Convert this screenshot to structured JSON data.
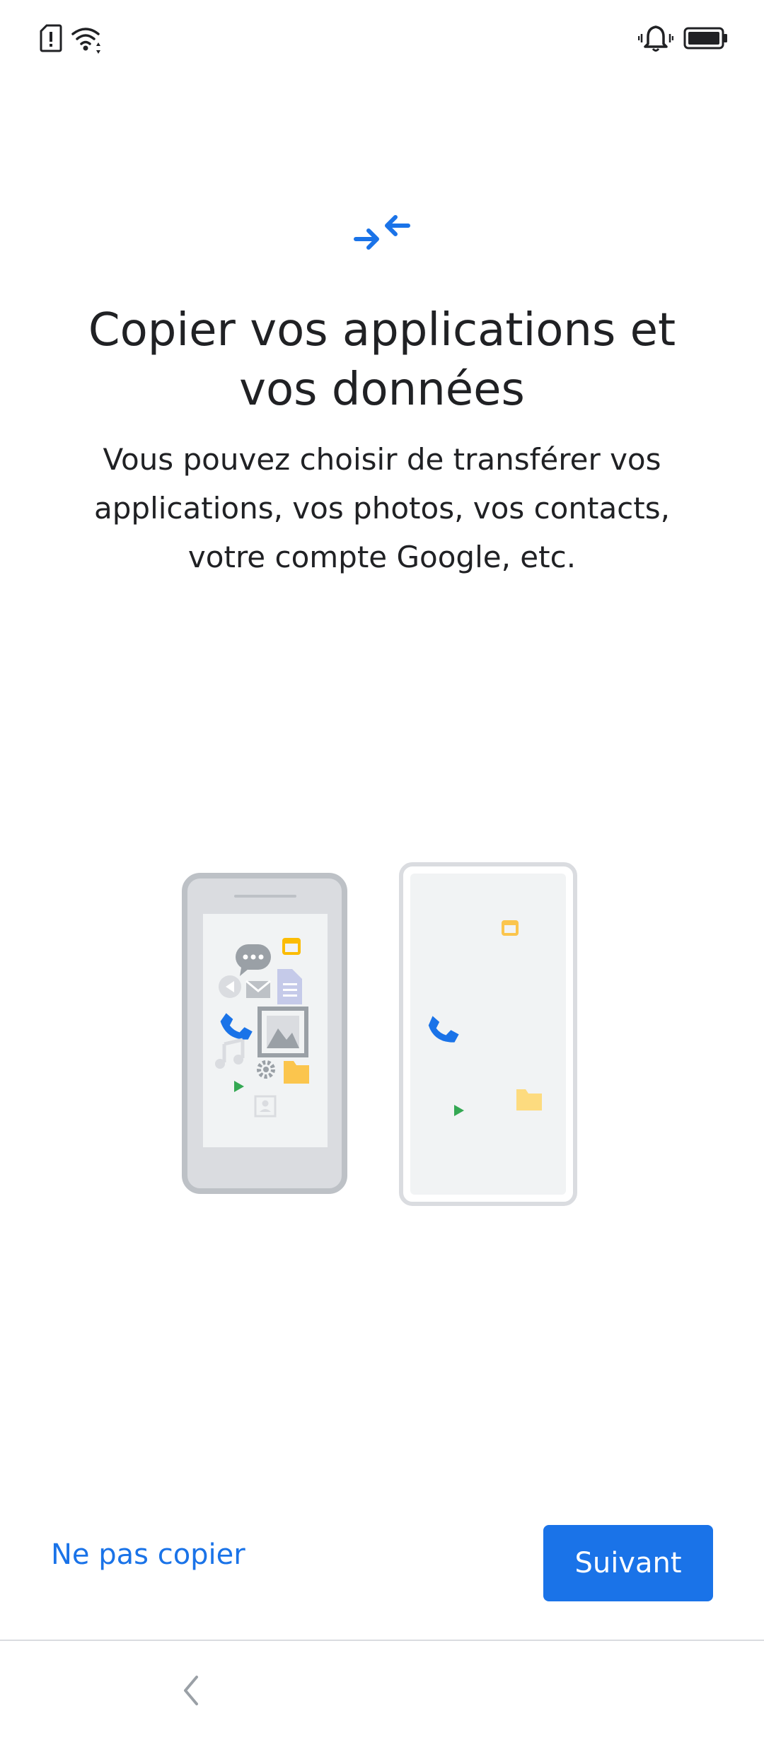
{
  "header": {
    "title": "Copier vos applications et vos données",
    "subtitle": "Vous pouvez choisir de transférer vos applications, vos photos, vos contacts, votre compte Google, etc."
  },
  "icons": {
    "status_left": [
      "sim-alert-icon",
      "wifi-icon"
    ],
    "status_right": [
      "vibrate-bell-icon",
      "battery-icon"
    ],
    "header": "transfer-arrows-icon",
    "nav": "back-icon"
  },
  "actions": {
    "skip_label": "Ne pas copier",
    "next_label": "Suivant"
  },
  "colors": {
    "accent": "#1a73e8",
    "text": "#202124",
    "phone_grey": "#bdc1c6",
    "icon_yellow": "#fbbc04",
    "icon_green": "#34a853"
  }
}
